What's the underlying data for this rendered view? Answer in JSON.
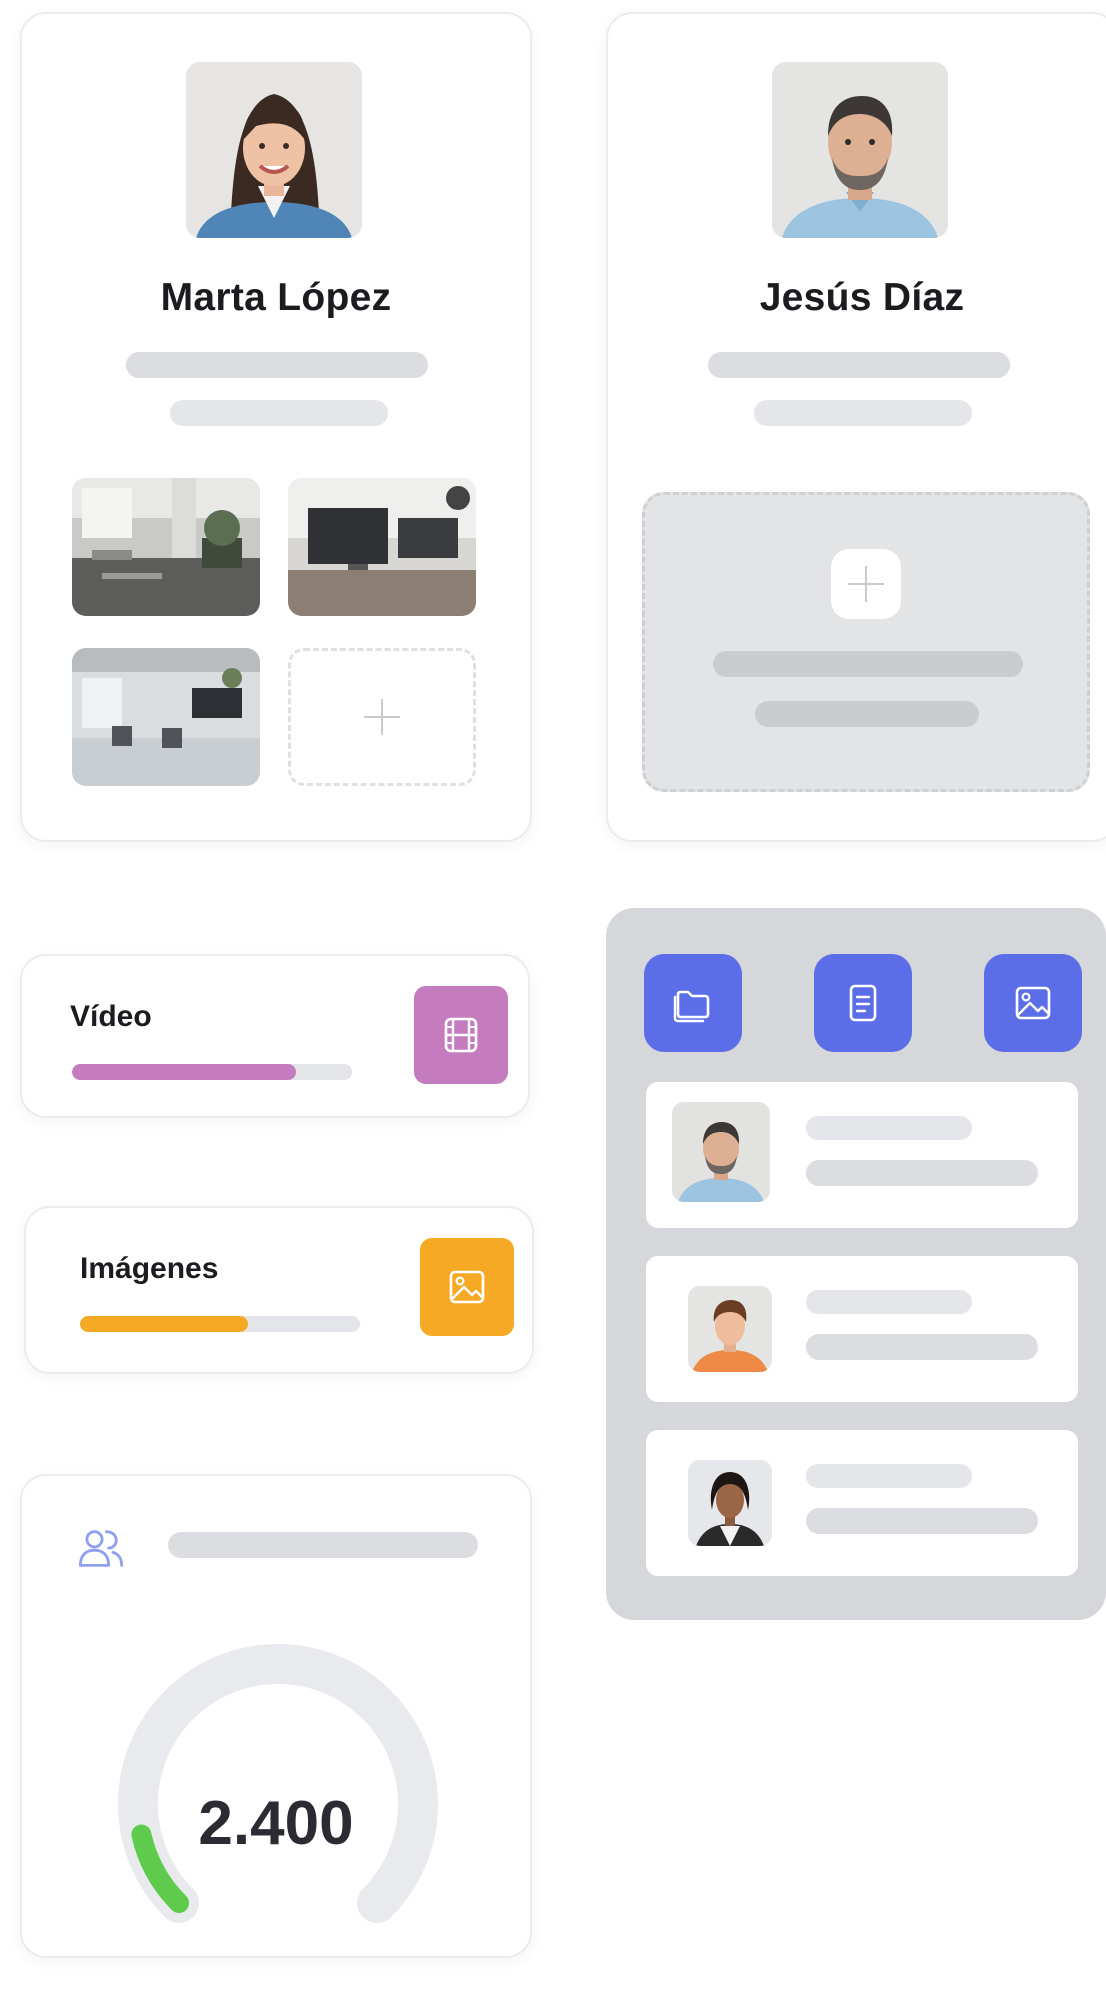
{
  "profiles": [
    {
      "name": "Marta López"
    },
    {
      "name": "Jesús Díaz"
    }
  ],
  "storage": {
    "video": {
      "label": "Vídeo",
      "progress_pct": 80,
      "color": "#c47cbe",
      "icon": "film-icon"
    },
    "images": {
      "label": "Imágenes",
      "progress_pct": 60,
      "color": "#f6a924",
      "icon": "image-icon"
    }
  },
  "stats": {
    "value": "2.400",
    "icon": "users-icon",
    "gauge_pct": 12,
    "gauge_color": "#5fcb4c"
  },
  "panel": {
    "icons": [
      "folder-icon",
      "document-icon",
      "image-icon"
    ],
    "accent": "#5b6ee8"
  }
}
